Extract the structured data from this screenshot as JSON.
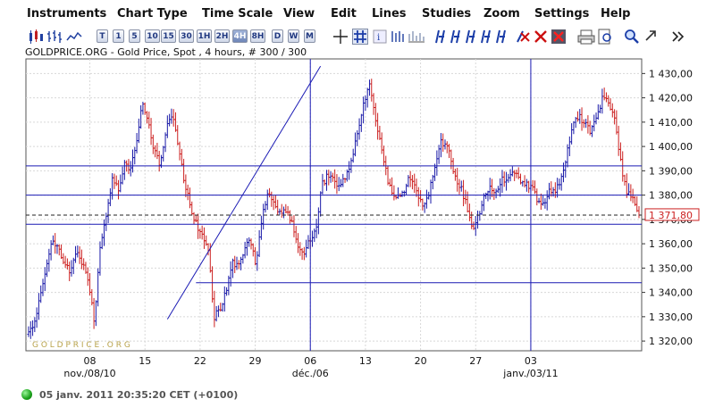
{
  "menu": [
    "Instruments",
    "Chart Type",
    "Time Scale",
    "View",
    "Edit",
    "Lines",
    "Studies",
    "Zoom",
    "Settings",
    "Help"
  ],
  "toolbar": {
    "interval_buttons": [
      "T",
      "1",
      "5",
      "10",
      "15",
      "30",
      "1H",
      "2H",
      "4H",
      "8H",
      "D",
      "W",
      "M"
    ],
    "selected_interval": "4H"
  },
  "info_line": "GOLDPRICE.ORG - Gold Price, Spot , 4 hours, # 300 / 300",
  "watermark": "G O L D P R I C E . O R G",
  "status": {
    "timestamp": "05 janv. 2011 20:35:20  CET (+0100)",
    "indicator_color": "#22aa22"
  },
  "colors": {
    "up": "#1a1aa8",
    "down": "#cc2020",
    "lines": "#1a1ab4",
    "grid": "#d8d8d8",
    "price_flag": "#cc2020"
  },
  "chart_data": {
    "type": "candlestick",
    "title": "GOLDPRICE.ORG - Gold Price, Spot , 4 hours, # 300 / 300",
    "ylim": [
      1316,
      1436
    ],
    "y_ticks": [
      1320,
      1330,
      1340,
      1350,
      1360,
      1370,
      1380,
      1390,
      1400,
      1410,
      1420,
      1430
    ],
    "y_tick_labels": [
      "1 320,00",
      "1 330,00",
      "1 340,00",
      "1 350,00",
      "1 360,00",
      "1 370,00",
      "1 380,00",
      "1 390,00",
      "1 400,00",
      "1 410,00",
      "1 420,00",
      "1 430,00"
    ],
    "x_ticks": [
      "08",
      "15",
      "22",
      "29",
      "06",
      "13",
      "20",
      "27",
      "03"
    ],
    "x_month_labels": [
      "nov./08/10",
      "déc./06",
      "janv./03/11"
    ],
    "last_price": 1371.8,
    "last_price_label": "1 371,80",
    "horizontal_lines": [
      1392,
      1380,
      1368,
      1344
    ],
    "dashed_line": 1371.8,
    "vertical_lines": [
      "06",
      "03"
    ],
    "trendline": {
      "from": 1329,
      "to": 1433
    },
    "price_path": [
      1323,
      1328,
      1340,
      1352,
      1362,
      1358,
      1352,
      1348,
      1356,
      1352,
      1345,
      1328,
      1360,
      1372,
      1388,
      1382,
      1393,
      1390,
      1402,
      1418,
      1410,
      1398,
      1392,
      1408,
      1414,
      1400,
      1386,
      1376,
      1368,
      1364,
      1358,
      1330,
      1333,
      1340,
      1352,
      1350,
      1358,
      1362,
      1350,
      1372,
      1380,
      1378,
      1372,
      1374,
      1368,
      1360,
      1354,
      1362,
      1366,
      1384,
      1388,
      1386,
      1384,
      1388,
      1394,
      1406,
      1418,
      1426,
      1410,
      1398,
      1386,
      1380,
      1378,
      1384,
      1388,
      1380,
      1376,
      1382,
      1394,
      1402,
      1400,
      1388,
      1384,
      1378,
      1366,
      1370,
      1378,
      1384,
      1382,
      1386,
      1386,
      1390,
      1386,
      1384,
      1384,
      1378,
      1376,
      1382,
      1382,
      1386,
      1398,
      1410,
      1412,
      1410,
      1406,
      1414,
      1420,
      1418,
      1412,
      1392,
      1380,
      1380,
      1370
    ]
  }
}
